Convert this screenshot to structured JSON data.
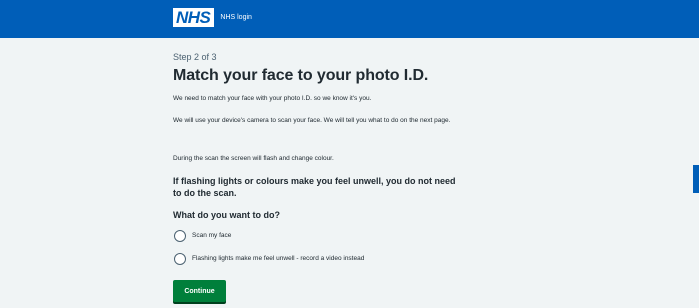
{
  "header": {
    "logo_text": "NHS",
    "service_name": "NHS login",
    "background": "#005eb8"
  },
  "main": {
    "step": "Step 2 of 3",
    "title": "Match your face to your photo I.D.",
    "paragraphs": [
      "We need to match your face with your photo I.D. so we know it's you.",
      "We will use your device's camera to scan your face. We will tell you what to do on the next page.",
      "During the scan the screen will flash and change colour."
    ],
    "warning": "If flashing lights or colours make you feel unwell, you do not need to do the scan.",
    "question": "What do you want to do?",
    "options": [
      {
        "label": "Scan my face",
        "selected": false
      },
      {
        "label": "Flashing lights make me feel unwell - record a video instead",
        "selected": false
      }
    ],
    "continue_label": "Continue"
  },
  "colors": {
    "page_background": "#f0f4f5",
    "primary_blue": "#005eb8",
    "button_green": "#007f3b",
    "text": "#212b32",
    "secondary_text": "#4c6272"
  }
}
